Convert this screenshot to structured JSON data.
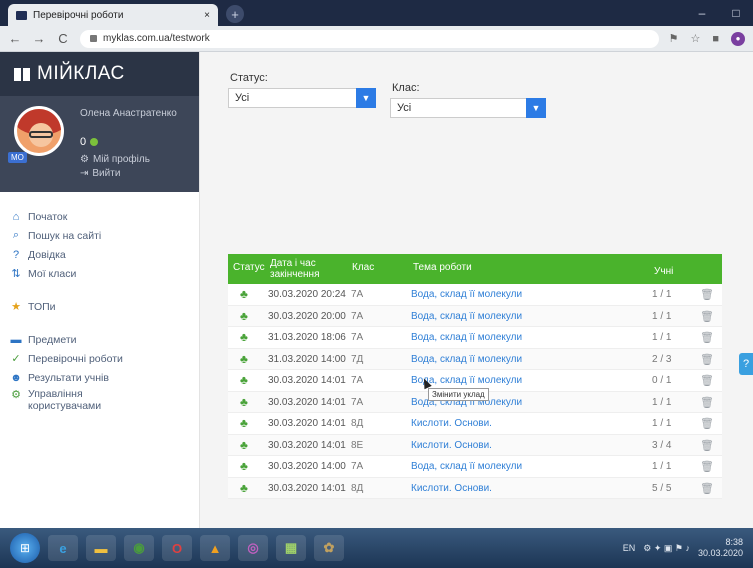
{
  "browser": {
    "tab_title": "Перевірочні роботи",
    "tab_close": "×",
    "new_tab": "+",
    "url": "myklas.com.ua/testwork",
    "back": "←",
    "forward": "→",
    "reload": "C"
  },
  "sidebar": {
    "brand": "МІЙКЛАС",
    "user": {
      "name": "Олена Анастратенко",
      "level": "МО",
      "score": "0",
      "profile_link": "Мій профіль",
      "logout_link": "Вийти"
    },
    "items": [
      {
        "label": "Початок",
        "icon": "home-icon",
        "glyph": "⌂"
      },
      {
        "label": "Пошук на сайті",
        "icon": "search-icon",
        "glyph": "⌕"
      },
      {
        "label": "Довідка",
        "icon": "help-circle-icon",
        "glyph": "?"
      },
      {
        "label": "Мої класи",
        "icon": "classes-icon",
        "glyph": "⇅"
      },
      {
        "label": "ТОПи",
        "icon": "star-icon",
        "glyph": "★"
      },
      {
        "label": "Предмети",
        "icon": "books-icon",
        "glyph": "▬"
      },
      {
        "label": "Перевірочні роботи",
        "icon": "check-circle-icon",
        "glyph": "✓"
      },
      {
        "label": "Результати учнів",
        "icon": "users-icon",
        "glyph": "☻"
      },
      {
        "label": "Управління користувачами",
        "icon": "user-manage-icon",
        "glyph": "⚙"
      }
    ]
  },
  "filters": {
    "status_label": "Статус:",
    "status_value": "Усі",
    "class_label": "Клас:",
    "class_value": "Усі"
  },
  "table": {
    "headers": {
      "status": "Статус",
      "date": "Дата і час закінчення",
      "class": "Клас",
      "topic": "Тема роботи",
      "students": "Учні"
    },
    "rows": [
      {
        "date": "30.03.2020 20:24",
        "class": "7А",
        "topic": "Вода, склад її молекули",
        "count": "1 / 1"
      },
      {
        "date": "30.03.2020 20:00",
        "class": "7А",
        "topic": "Вода, склад її молекули",
        "count": "1 / 1"
      },
      {
        "date": "31.03.2020 18:06",
        "class": "7А",
        "topic": "Вода, склад її молекули",
        "count": "1 / 1"
      },
      {
        "date": "31.03.2020 14:00",
        "class": "7Д",
        "topic": "Вода, склад її молекули",
        "count": "2 / 3"
      },
      {
        "date": "30.03.2020 14:01",
        "class": "7А",
        "topic": "Вода, склад її молекули",
        "count": "0 / 1"
      },
      {
        "date": "30.03.2020 14:01",
        "class": "7А",
        "topic": "Вода, склад її молекули",
        "count": "1 / 1"
      },
      {
        "date": "30.03.2020 14:01",
        "class": "8Д",
        "topic": "Кислоти. Основи.",
        "count": "1 / 1"
      },
      {
        "date": "30.03.2020 14:01",
        "class": "8Е",
        "topic": "Кислоти. Основи.",
        "count": "3 / 4"
      },
      {
        "date": "30.03.2020 14:00",
        "class": "7А",
        "topic": "Вода, склад її молекули",
        "count": "1 / 1"
      },
      {
        "date": "30.03.2020 14:01",
        "class": "8Д",
        "topic": "Кислоти. Основи.",
        "count": "5 / 5"
      }
    ]
  },
  "tooltip": "Змінити уклад",
  "help_tab": "?",
  "taskbar": {
    "lang": "EN",
    "time": "8:38",
    "date": "30.03.2020"
  },
  "colors": {
    "header_green": "#4ab32c",
    "link_blue": "#2f7fd6",
    "select_blue": "#2c7be5",
    "brand_dark": "#2b3445"
  }
}
